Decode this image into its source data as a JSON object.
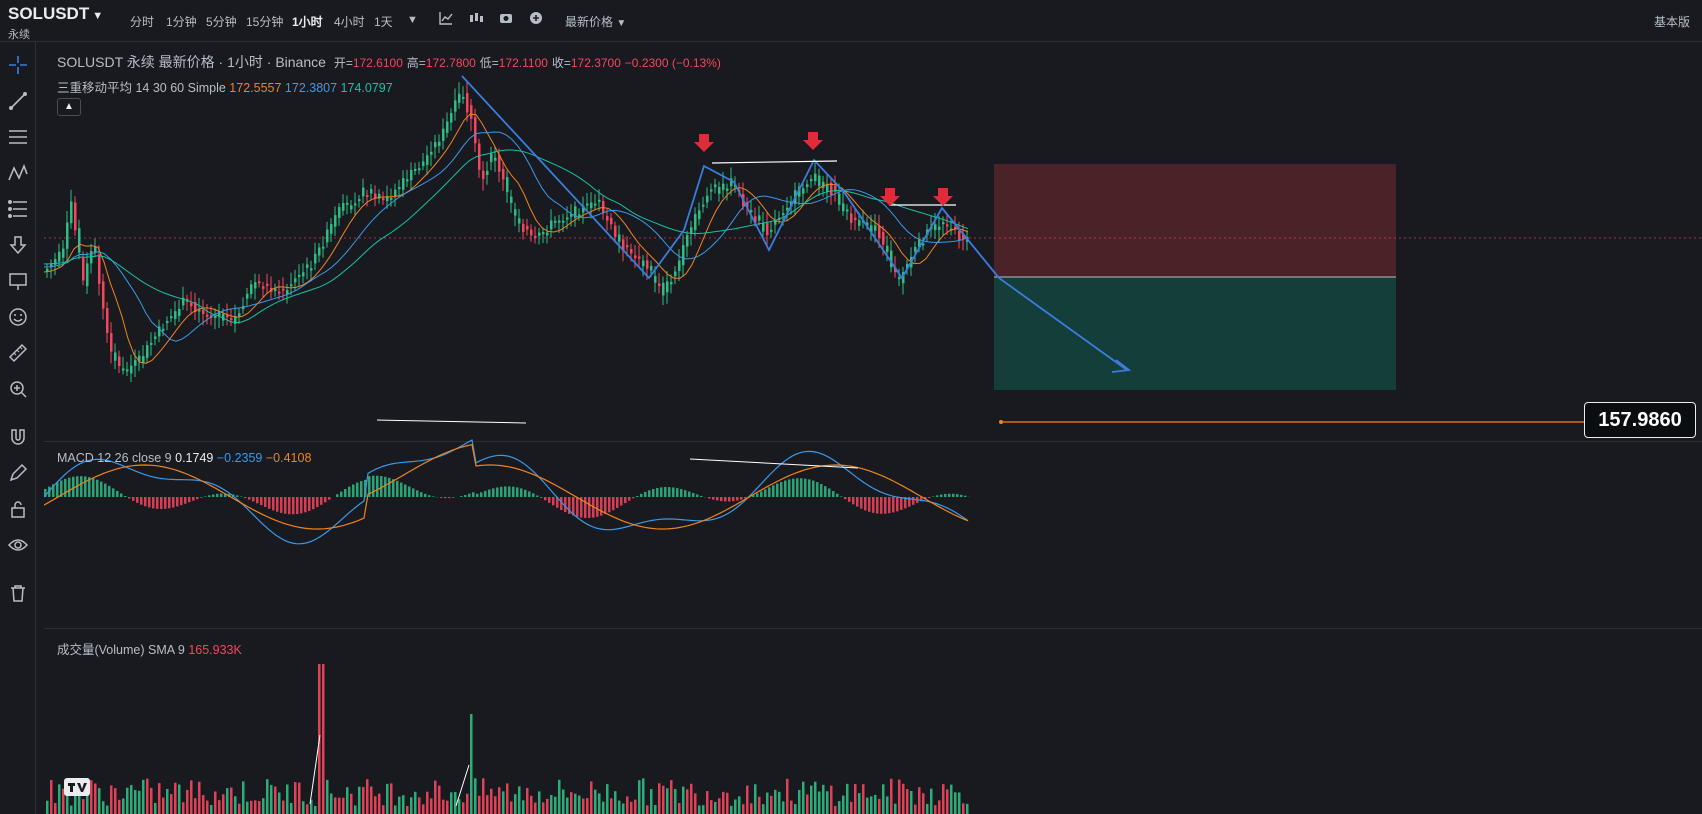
{
  "header": {
    "symbol": "SOLUSDT",
    "contract_type": "永续",
    "timeframes": [
      "分时",
      "1分钟",
      "5分钟",
      "15分钟",
      "1小时",
      "4小时",
      "1天"
    ],
    "active_timeframe": "1小时",
    "price_type": "最新价格",
    "mode": "基本版"
  },
  "legend": {
    "title": "SOLUSDT 永续 最新价格 · 1小时 · Binance",
    "open_label": "开=",
    "open": "172.6100",
    "high_label": "高=",
    "high": "172.7800",
    "low_label": "低=",
    "low": "172.1100",
    "close_label": "收=",
    "close": "172.3700",
    "change": "−0.2300 (−0.13%)",
    "ma_label": "三重移动平均 14 30 60 Simple",
    "ma14": "172.5557",
    "ma30": "172.3807",
    "ma60": "174.0797"
  },
  "macd": {
    "label": "MACD 12 26 close 9",
    "macd": "0.1749",
    "signal": "−0.2359",
    "hist": "−0.4108"
  },
  "volume": {
    "label": "成交量(Volume) SMA 9",
    "value": "165.933K"
  },
  "price_tag": "157.9860",
  "colors": {
    "bg": "#181a20",
    "up": "#2ebd85",
    "down": "#f6465d",
    "ma14": "#f0831e",
    "ma30": "#3b99e8",
    "ma60": "#18c2a2",
    "pattern": "#3b7ddd",
    "stop_zone": "#4a2228",
    "target_zone": "#143e3a"
  },
  "toolbar_icons": [
    "crosshair-icon",
    "trend-line-icon",
    "horizontal-lines-icon",
    "pattern-icon",
    "fib-icon",
    "arrow-down-icon",
    "text-note-icon",
    "emoji-icon",
    "ruler-icon",
    "zoom-in-icon",
    "magnet-icon",
    "pencil-lock-icon",
    "lock-icon",
    "eye-icon",
    "trash-icon"
  ]
}
